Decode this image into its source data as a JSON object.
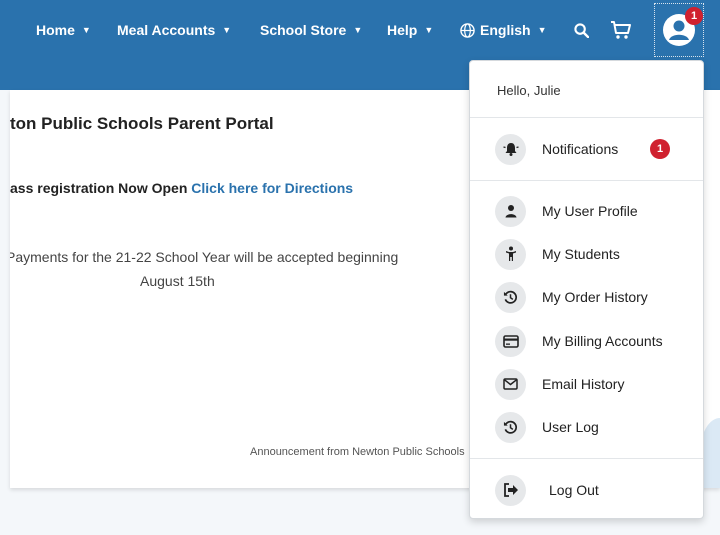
{
  "nav": {
    "home": "Home",
    "meal_accounts": "Meal Accounts",
    "school_store": "School Store",
    "help": "Help",
    "language": "English",
    "avatar_badge": "1"
  },
  "content": {
    "portal_title": "ton Public Schools Parent Portal",
    "class_reg_text": "ass registration Now Open ",
    "class_reg_link": "Click here for Directions",
    "payments_line1": "Payments for the 21-22 School Year will be accepted beginning",
    "payments_line2": "August 15th",
    "announcement": "Announcement from Newton Public Schools"
  },
  "dropdown": {
    "greeting": "Hello, Julie",
    "notifications_label": "Notifications",
    "notifications_count": "1",
    "items": [
      {
        "label": "My User Profile",
        "icon": "user-icon"
      },
      {
        "label": "My Students",
        "icon": "student-icon"
      },
      {
        "label": "My Order History",
        "icon": "history-icon"
      },
      {
        "label": "My Billing Accounts",
        "icon": "credit-card-icon"
      },
      {
        "label": "Email History",
        "icon": "envelope-icon"
      },
      {
        "label": "User Log",
        "icon": "history-icon"
      }
    ],
    "logout_label": "Log Out"
  },
  "colors": {
    "brand_blue": "#2a72ad",
    "badge_red": "#d0212f"
  }
}
